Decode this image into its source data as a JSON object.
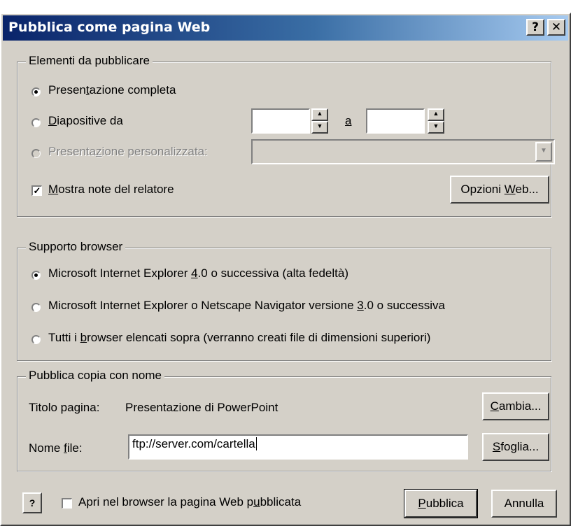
{
  "window": {
    "title": "Pubblica come pagina Web",
    "help_glyph": "?",
    "close_glyph": "✕"
  },
  "elements_group": {
    "legend": "Elementi da pubblicare",
    "opt_full": {
      "pre": "Presen",
      "mn": "t",
      "post": "azione completa"
    },
    "opt_slides": {
      "pre": "",
      "mn": "D",
      "post": "iapositive da"
    },
    "slides_to": "a",
    "opt_custom": {
      "pre": "Presenta",
      "mn": "z",
      "post": "ione personalizzata:"
    },
    "show_notes": {
      "pre": "",
      "mn": "M",
      "post": "ostra note del relatore"
    },
    "web_options_btn": {
      "pre": "Opzioni ",
      "mn": "W",
      "post": "eb..."
    }
  },
  "browser_group": {
    "legend": "Supporto browser",
    "opt_ie4": {
      "pre": "Microsoft Internet Explorer ",
      "mn": "4",
      "post": ".0 o successiva (alta fedeltà)"
    },
    "opt_ie3": {
      "pre": "Microsoft Internet Explorer o Netscape Navigator versione ",
      "mn": "3",
      "post": ".0 o successiva"
    },
    "opt_all": {
      "pre": "Tutti i ",
      "mn": "b",
      "post": "rowser elencati sopra (verranno creati file di dimensioni superiori)"
    }
  },
  "publish_group": {
    "legend": "Pubblica copia con nome",
    "page_title_label": "Titolo pagina:",
    "page_title_value": "Presentazione di PowerPoint",
    "change_btn": {
      "pre": "",
      "mn": "C",
      "post": "ambia..."
    },
    "file_name_label": {
      "pre": "Nome ",
      "mn": "f",
      "post": "ile:"
    },
    "file_name_value": "ftp://server.com/cartella",
    "browse_btn": {
      "pre": "",
      "mn": "S",
      "post": "foglia..."
    }
  },
  "footer": {
    "open_in_browser": {
      "pre": "Apri nel browser la pagina Web p",
      "mn": "u",
      "post": "bblicata"
    },
    "publish_btn": {
      "pre": "",
      "mn": "P",
      "post": "ubblica"
    },
    "cancel_btn": "Annulla"
  }
}
